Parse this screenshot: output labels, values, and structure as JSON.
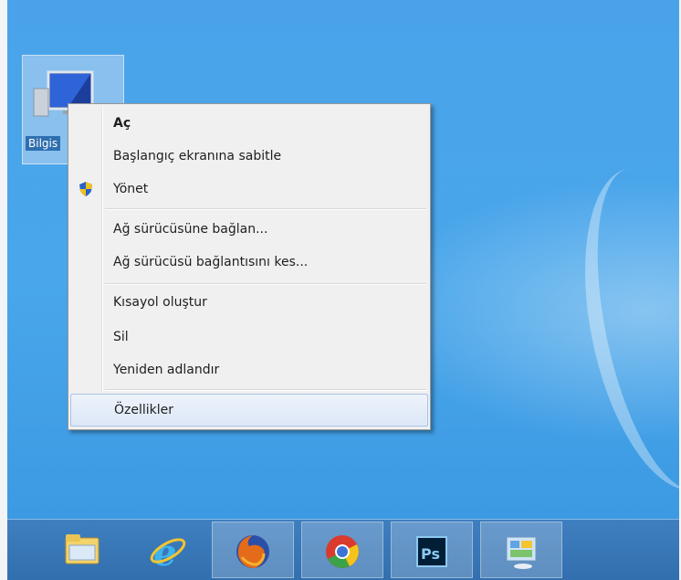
{
  "desktop": {
    "icon_label": "Bilgis"
  },
  "context_menu": {
    "items": [
      {
        "label": "Aç",
        "bold": true
      },
      {
        "label": "Başlangıç ekranına sabitle"
      },
      {
        "label": "Yönet",
        "icon": "uac-shield-icon"
      },
      {
        "label": "Ağ sürücüsüne bağlan..."
      },
      {
        "label": "Ağ sürücüsü bağlantısını kes..."
      },
      {
        "label": "Kısayol oluştur"
      },
      {
        "label": "Sil"
      },
      {
        "label": "Yeniden adlandır"
      },
      {
        "label": "Özellikler",
        "highlighted": true
      }
    ]
  },
  "taskbar": {
    "buttons": [
      {
        "icon": "file-explorer-icon"
      },
      {
        "icon": "internet-explorer-icon"
      },
      {
        "icon": "firefox-icon"
      },
      {
        "icon": "chrome-icon"
      },
      {
        "icon": "photoshop-icon",
        "text": "Ps"
      },
      {
        "icon": "control-panel-icon"
      }
    ]
  },
  "colors": {
    "desktop_background": "#49a6ea",
    "taskbar": "#3a78b8",
    "menu_background": "#f0f0f0",
    "menu_highlight": "#dce7f6"
  }
}
